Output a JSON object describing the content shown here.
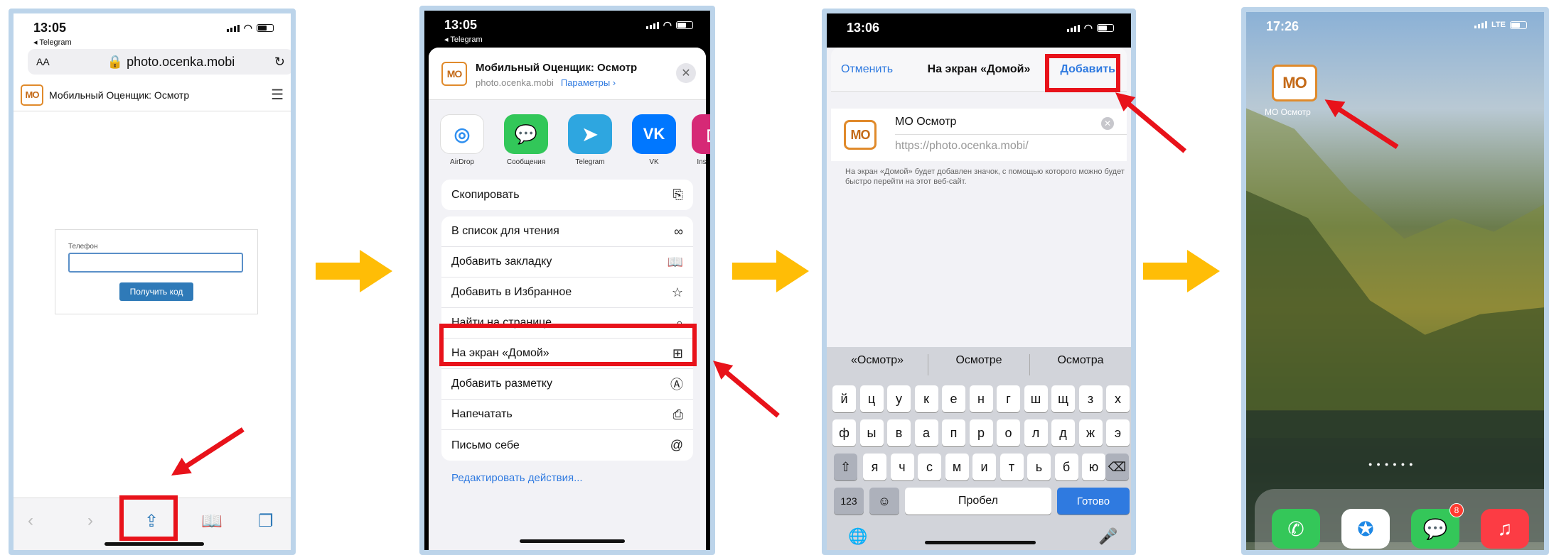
{
  "phone1": {
    "time": "13:05",
    "back_app": "◂ Telegram",
    "text_size": "AA",
    "url": "photo.ocenka.mobi",
    "logo_text": "MO",
    "site_title": "Мобильный Оценщик: Осмотр",
    "field_label": "Телефон",
    "get_code_button": "Получить код"
  },
  "phone2": {
    "time": "13:05",
    "back_app": "◂ Telegram",
    "logo_text": "MO",
    "share_title": "Мобильный Оценщик: Осмотр",
    "share_domain": "photo.ocenka.mobi",
    "share_params": "Параметры",
    "apps": [
      "AirDrop",
      "Сообщения",
      "Telegram",
      "VK",
      "Ins"
    ],
    "actions_group1": [
      "Скопировать"
    ],
    "actions_group2": [
      "В список для чтения",
      "Добавить закладку",
      "Добавить в Избранное",
      "Найти на странице",
      "На экран «Домой»",
      "Добавить разметку",
      "Напечатать",
      "Письмо себе"
    ],
    "edit_actions": "Редактировать действия..."
  },
  "phone3": {
    "time": "13:06",
    "cancel": "Отменить",
    "title": "На экран «Домой»",
    "add": "Добавить",
    "logo_text": "MO",
    "name_value": "МО Осмотр",
    "url_value": "https://photo.ocenka.mobi/",
    "note": "На экран «Домой» будет добавлен значок, с помощью которого можно будет быстро перейти на этот веб-сайт.",
    "suggestions": [
      "«Осмотр»",
      "Осмотре",
      "Осмотра"
    ],
    "row1": [
      "й",
      "ц",
      "у",
      "к",
      "е",
      "н",
      "г",
      "ш",
      "щ",
      "з",
      "х"
    ],
    "row2": [
      "ф",
      "ы",
      "в",
      "а",
      "п",
      "р",
      "о",
      "л",
      "д",
      "ж",
      "э"
    ],
    "row3": [
      "я",
      "ч",
      "с",
      "м",
      "и",
      "т",
      "ь",
      "б",
      "ю"
    ],
    "key_123": "123",
    "space": "Пробел",
    "done": "Готово"
  },
  "phone4": {
    "time": "17:26",
    "network": "LTE",
    "logo_text": "MO",
    "icon_label": "МО Осмотр",
    "badge": "8"
  }
}
